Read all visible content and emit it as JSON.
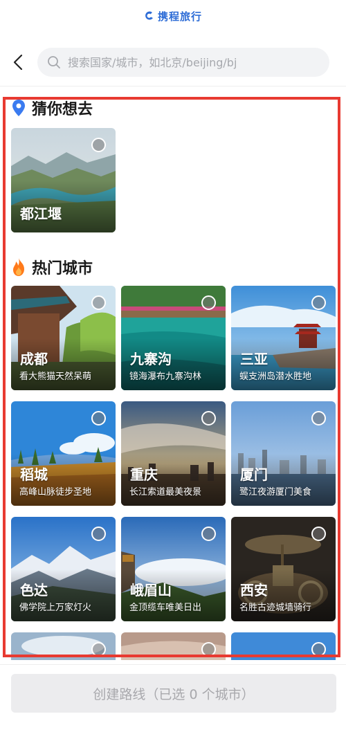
{
  "header": {
    "brand": "携程旅行"
  },
  "search": {
    "placeholder": "搜索国家/城市，如北京/beijing/bj"
  },
  "sections": {
    "guess": {
      "title": "猜你想去"
    },
    "hot": {
      "title": "热门城市"
    }
  },
  "guess_items": [
    {
      "name": "都江堰",
      "sub": ""
    }
  ],
  "hot_cities": [
    {
      "name": "成都",
      "sub": "看大熊猫天然呆萌"
    },
    {
      "name": "九寨沟",
      "sub": "镜海瀑布九寨沟林"
    },
    {
      "name": "三亚",
      "sub": "蜈支洲岛潜水胜地"
    },
    {
      "name": "稻城",
      "sub": "高峰山脉徒步圣地"
    },
    {
      "name": "重庆",
      "sub": "长江索道最美夜景"
    },
    {
      "name": "厦门",
      "sub": "鹭江夜游厦门美食"
    },
    {
      "name": "色达",
      "sub": "佛学院上万家灯火"
    },
    {
      "name": "峨眉山",
      "sub": "金顶缆车唯美日出"
    },
    {
      "name": "西安",
      "sub": "名胜古迹城墙骑行"
    }
  ],
  "footer": {
    "create_button": "创建路线（已选 0 个城市）"
  },
  "colors": {
    "brand": "#2d6cd6",
    "highlight": "#e83a31"
  }
}
